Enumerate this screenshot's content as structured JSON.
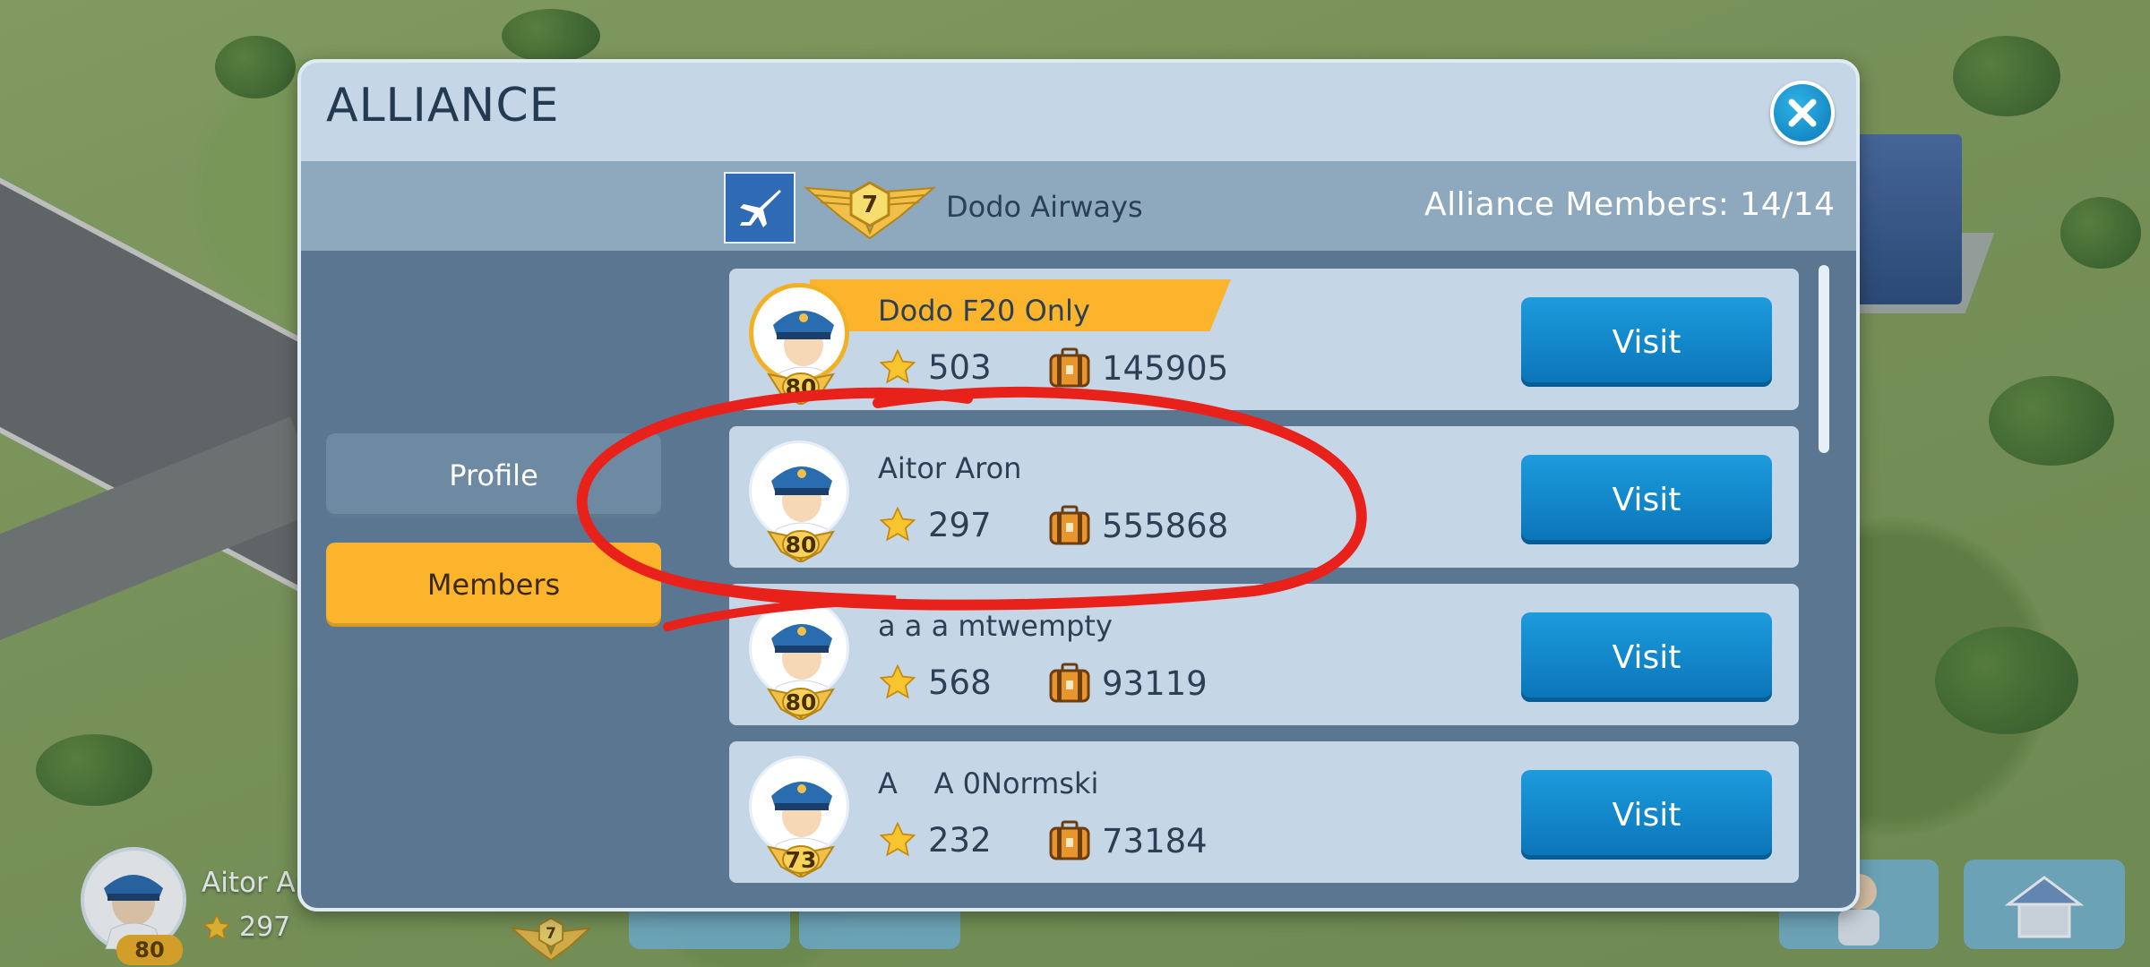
{
  "dialog": {
    "title": "ALLIANCE",
    "close_icon": "close-icon"
  },
  "alliance": {
    "rank": "7",
    "name": "Dodo Airways",
    "members_count": "Alliance Members: 14/14"
  },
  "tabs": [
    {
      "label": "Profile",
      "active": false
    },
    {
      "label": "Members",
      "active": true
    }
  ],
  "members": [
    {
      "name": "Dodo F20 Only",
      "level": "80",
      "stars": "503",
      "cargo": "145905",
      "visit_label": "Visit",
      "leader": true
    },
    {
      "name": "Aitor Aron",
      "level": "80",
      "stars": "297",
      "cargo": "555868",
      "visit_label": "Visit",
      "leader": false
    },
    {
      "name": "a a a mtwempty",
      "level": "80",
      "stars": "568",
      "cargo": "93119",
      "visit_label": "Visit",
      "leader": false
    },
    {
      "name": "A    A 0Normski",
      "level": "73",
      "stars": "232",
      "cargo": "73184",
      "visit_label": "Visit",
      "leader": false
    }
  ],
  "hud": {
    "player_name": "Aitor Aron",
    "player_stars": "297",
    "player_level": "80",
    "alliance_rank": "7"
  },
  "colors": {
    "accent_gold": "#fbb42c",
    "button_blue": "#0a8fd0",
    "annotation_red": "#e8221b"
  }
}
